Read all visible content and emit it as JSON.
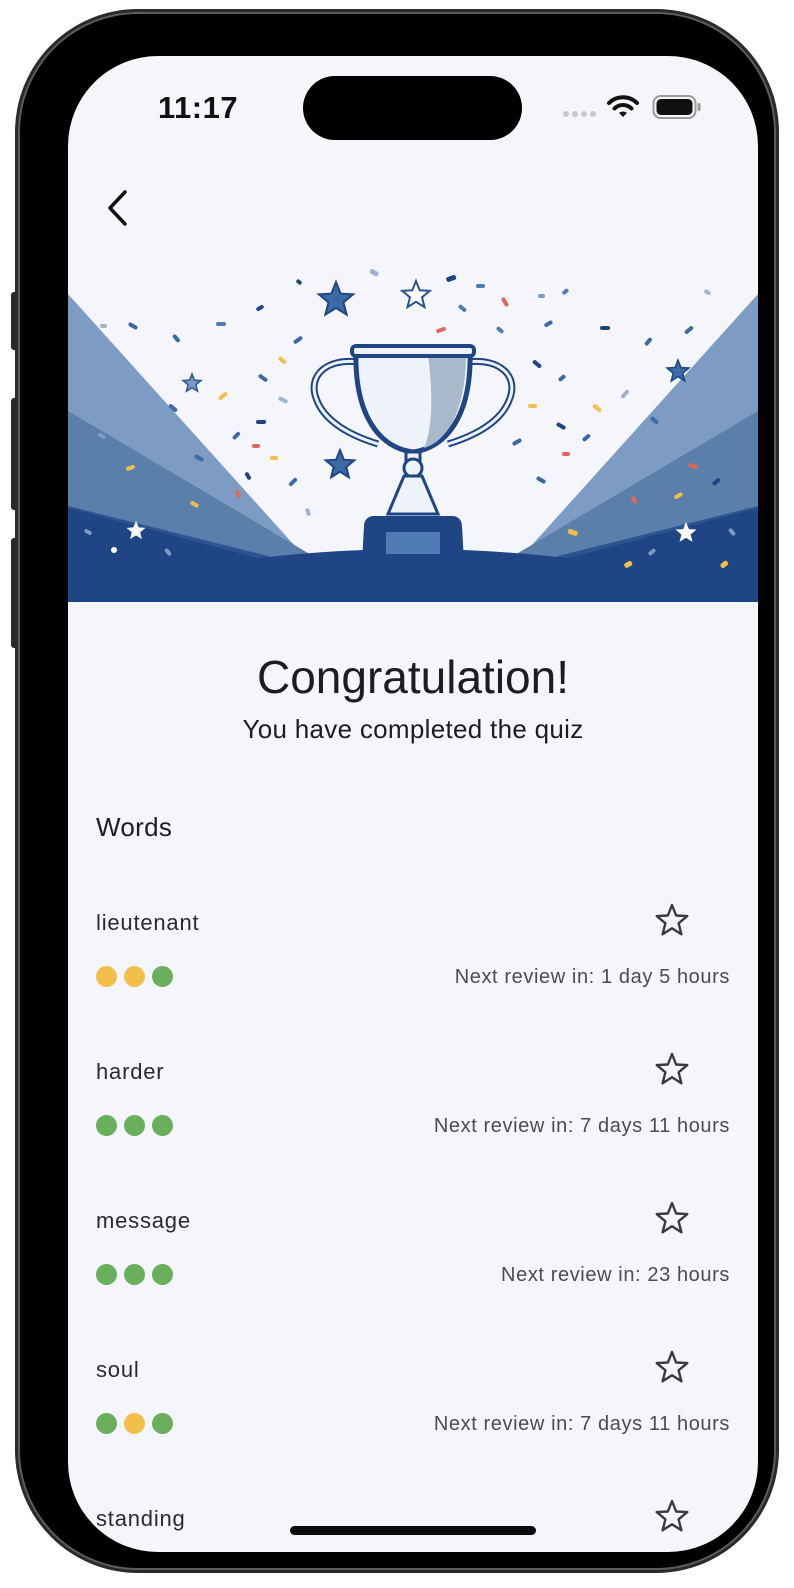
{
  "status_bar": {
    "time": "11:17"
  },
  "header": {
    "back_icon": "chevron-left-icon"
  },
  "hero": {
    "image": "trophy-with-confetti-illustration"
  },
  "congrats": {
    "title": "Congratulation!",
    "subtitle": "You have completed the quiz"
  },
  "words_section": {
    "title": "Words",
    "items": [
      {
        "word": "lieutenant",
        "review": "Next review in: 1 day 5 hours",
        "dots": [
          "yellow",
          "yellow",
          "green"
        ]
      },
      {
        "word": "harder",
        "review": "Next review in: 7 days 11 hours",
        "dots": [
          "green",
          "green",
          "green"
        ]
      },
      {
        "word": "message",
        "review": "Next review in: 23 hours",
        "dots": [
          "green",
          "green",
          "green"
        ]
      },
      {
        "word": "soul",
        "review": "Next review in: 7 days 11 hours",
        "dots": [
          "green",
          "yellow",
          "green"
        ]
      },
      {
        "word": "standing",
        "review": "",
        "dots": []
      }
    ]
  },
  "colors": {
    "background": "#f5f6fb",
    "dot_green": "#6aaf5c",
    "dot_yellow": "#f2c04a",
    "hero_navy": "#1f4585"
  }
}
